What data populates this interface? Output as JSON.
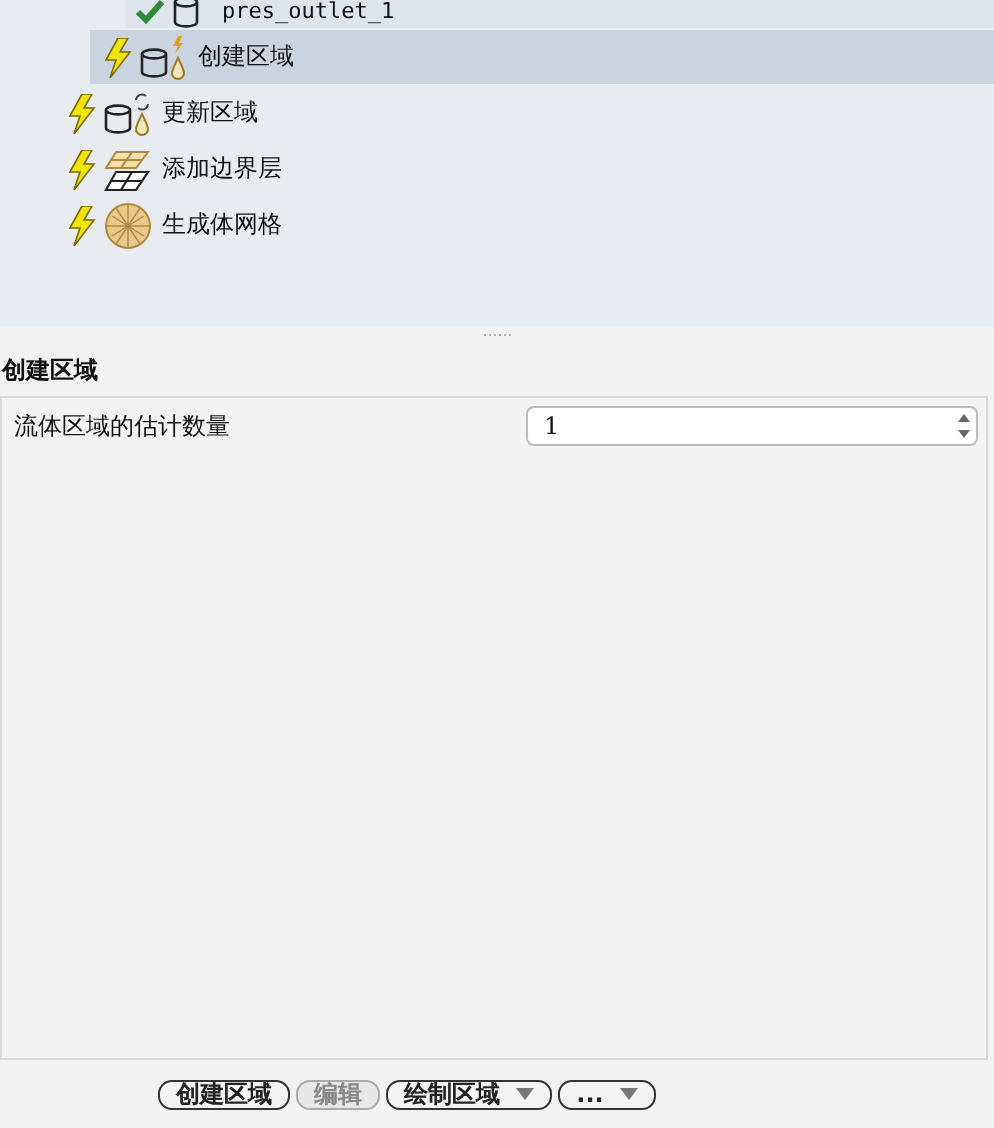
{
  "tree": [
    {
      "children": [
        {
          "children": [
            {
              "label": "pres_outlet_1",
              "done": true,
              "kind": "cylinder",
              "selected": false
            }
          ]
        },
        {
          "label": "创建区域",
          "done": false,
          "kind": "create",
          "selected": true
        }
      ]
    },
    {
      "label": "更新区域",
      "done": false,
      "kind": "update",
      "selected": false
    },
    {
      "label": "添加边界层",
      "done": false,
      "kind": "layers",
      "selected": false
    },
    {
      "label": "生成体网格",
      "done": false,
      "kind": "mesh",
      "selected": false
    }
  ],
  "panel": {
    "title": "创建区域",
    "fields": [
      {
        "label": "流体区域的估计数量",
        "value": "1"
      }
    ]
  },
  "buttons": [
    {
      "label": "创建区域",
      "kind": "plain",
      "disabled": false
    },
    {
      "label": "编辑",
      "kind": "plain",
      "disabled": true
    },
    {
      "label": "绘制区域",
      "kind": "dropdown",
      "disabled": false
    },
    {
      "label": "...",
      "kind": "dropdown",
      "disabled": false
    }
  ]
}
